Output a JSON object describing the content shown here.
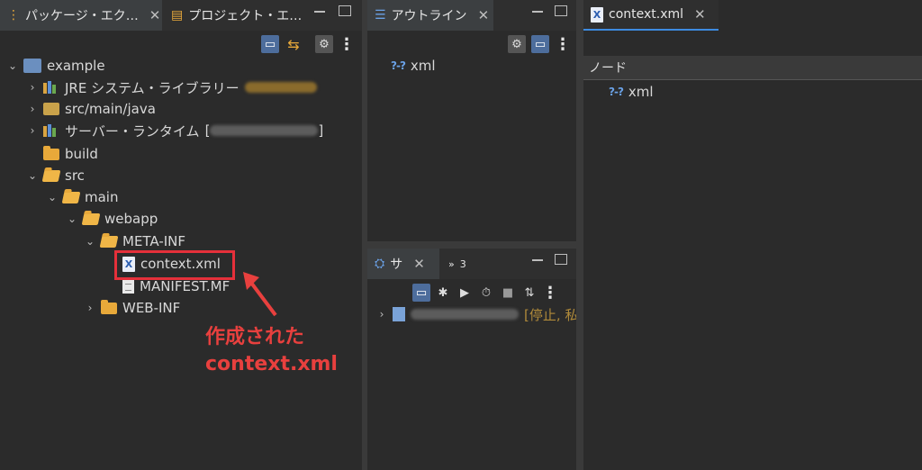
{
  "package_explorer": {
    "tab_active_label": "パッケージ・エク…",
    "tab2_label": "プロジェクト・エ…",
    "tree": {
      "project": "example",
      "jre": "JRE システム・ライブラリー",
      "src_main_java": "src/main/java",
      "server_runtime": "サーバー・ランタイム",
      "server_runtime_open": "[",
      "server_runtime_close": "]",
      "build": "build",
      "src": "src",
      "main": "main",
      "webapp": "webapp",
      "meta_inf": "META-INF",
      "context_xml": "context.xml",
      "manifest": "MANIFEST.MF",
      "web_inf": "WEB-INF"
    },
    "annotation_line1": "作成された",
    "annotation_line2": "context.xml",
    "annotation_color": "#e8403e"
  },
  "outline": {
    "tab_label": "アウトライン",
    "item": "xml"
  },
  "servers": {
    "tab_label": "サ",
    "other_tabs_label": "3",
    "status": "[停止, 私"
  },
  "editor": {
    "tab_label": "context.xml",
    "column_header": "ノード",
    "item": "xml",
    "accent": "#3d8be0"
  }
}
